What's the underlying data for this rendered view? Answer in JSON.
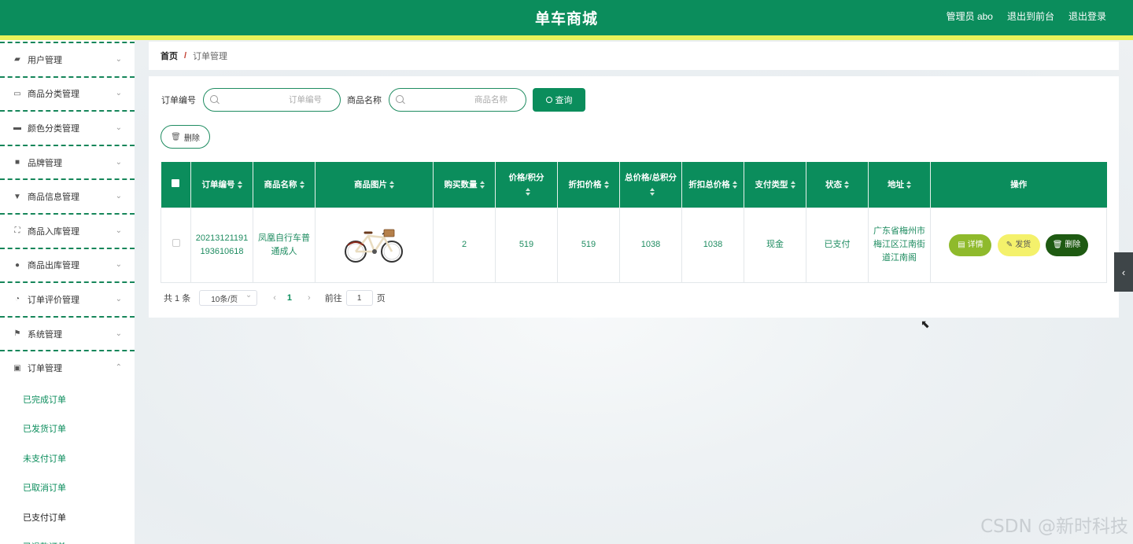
{
  "header": {
    "title": "单车商城",
    "admin_label": "管理员 abo",
    "front_label": "退出到前台",
    "logout_label": "退出登录"
  },
  "sidebar": {
    "items": [
      {
        "label": "用户管理",
        "icon": "ticket-icon"
      },
      {
        "label": "商品分类管理",
        "icon": "id-card-icon"
      },
      {
        "label": "颜色分类管理",
        "icon": "briefcase-icon"
      },
      {
        "label": "品牌管理",
        "icon": "folder-icon"
      },
      {
        "label": "商品信息管理",
        "icon": "pushpin-icon"
      },
      {
        "label": "商品入库管理",
        "icon": "fullscreen-icon"
      },
      {
        "label": "商品出库管理",
        "icon": "map-pin-icon"
      },
      {
        "label": "订单评价管理",
        "icon": "clock-icon"
      },
      {
        "label": "系统管理",
        "icon": "flag-icon"
      },
      {
        "label": "订单管理",
        "icon": "chart-icon"
      }
    ],
    "sub_items": [
      "已完成订单",
      "已发货订单",
      "未支付订单",
      "已取消订单",
      "已支付订单",
      "已退款订单"
    ]
  },
  "breadcrumb": {
    "home": "首页",
    "separator": "/",
    "current": "订单管理"
  },
  "search": {
    "order_label": "订单编号",
    "order_placeholder": "订单编号",
    "product_label": "商品名称",
    "product_placeholder": "商品名称",
    "query_label": "查询"
  },
  "delete_label": "删除",
  "table": {
    "headers": {
      "order_no": "订单编号",
      "product_name": "商品名称",
      "product_image": "商品图片",
      "quantity": "购买数量",
      "price": "价格/积分",
      "discount_price": "折扣价格",
      "total": "总价格/总积分",
      "discount_total": "折扣总价格",
      "pay_type": "支付类型",
      "status": "状态",
      "address": "地址",
      "actions": "操作"
    },
    "row": {
      "order_no": "20213121191193610618",
      "product_name": "凤凰自行车普通成人",
      "quantity": "2",
      "price": "519",
      "discount_price": "519",
      "total": "1038",
      "discount_total": "1038",
      "pay_type": "现金",
      "status": "已支付",
      "address": "广东省梅州市梅江区江南街道江南阁",
      "detail_label": "详情",
      "ship_label": "发货",
      "delete_label": "删除"
    }
  },
  "pagination": {
    "total": "共 1 条",
    "page_size": "10条/页",
    "current_page": "1",
    "goto_label": "前往",
    "goto_value": "1",
    "page_unit": "页"
  },
  "watermark": "CSDN @新时科技",
  "colors": {
    "primary": "#0b8d5c",
    "accent_yellow": "#e8f25a",
    "detail": "#8fba2c",
    "ship": "#f4f16b",
    "danger": "#1e5a12"
  }
}
